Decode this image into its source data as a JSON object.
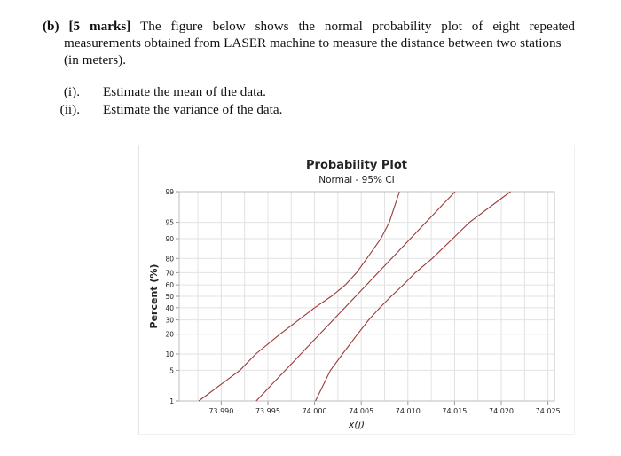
{
  "question": {
    "label": "(b)",
    "marks": "[5 marks]",
    "line1_rest": "The figure below shows the normal probability plot of eight repeated",
    "line2": "measurements obtained from LASER machine to measure the distance between two stations",
    "line3": "(in meters).",
    "parts": [
      {
        "num": "(i).",
        "text": "Estimate the mean of the data."
      },
      {
        "num": "(ii).",
        "text": "Estimate the variance of the data."
      }
    ]
  },
  "chart_data": {
    "type": "line",
    "title": "Probability Plot",
    "subtitle": "Normal - 95% CI",
    "xlabel": "x(j)",
    "ylabel": "Percent (%)",
    "x_ticks": [
      "73.990",
      "73.995",
      "74.000",
      "74.005",
      "74.010",
      "74.015",
      "74.020",
      "74.025"
    ],
    "x_tick_values": [
      73.99,
      73.995,
      74.0,
      74.005,
      74.01,
      74.015,
      74.02,
      74.025
    ],
    "xlim": [
      73.9855,
      74.0257
    ],
    "y_ticks": [
      "1",
      "5",
      "10",
      "20",
      "30",
      "40",
      "50",
      "60",
      "70",
      "80",
      "90",
      "95",
      "99"
    ],
    "y_tick_values": [
      1,
      5,
      10,
      20,
      30,
      40,
      50,
      60,
      70,
      80,
      90,
      95,
      99
    ],
    "ylim": [
      1,
      99
    ],
    "y_scale": "normal-probability",
    "grid": true,
    "line_color": "#9b3a3a",
    "series": [
      {
        "name": "fitted-line",
        "mean": 74.0044,
        "sd": 0.00458
      },
      {
        "name": "lower-ci-band",
        "points": [
          [
            73.9876,
            1
          ],
          [
            73.992,
            5
          ],
          [
            73.9937,
            10
          ],
          [
            73.9963,
            20
          ],
          [
            73.9983,
            30
          ],
          [
            74.0,
            40
          ],
          [
            74.0018,
            50
          ],
          [
            74.0033,
            60
          ],
          [
            74.0045,
            70
          ],
          [
            74.0056,
            80
          ],
          [
            74.0071,
            90
          ],
          [
            74.008,
            95
          ],
          [
            74.0091,
            99
          ]
        ]
      },
      {
        "name": "upper-ci-band",
        "points": [
          [
            74.0001,
            1
          ],
          [
            74.0017,
            5
          ],
          [
            74.003,
            10
          ],
          [
            74.0046,
            20
          ],
          [
            74.0058,
            30
          ],
          [
            74.007,
            40
          ],
          [
            74.0082,
            50
          ],
          [
            74.0095,
            60
          ],
          [
            74.0108,
            70
          ],
          [
            74.0126,
            80
          ],
          [
            74.0148,
            90
          ],
          [
            74.0166,
            95
          ],
          [
            74.021,
            99
          ]
        ]
      }
    ]
  }
}
